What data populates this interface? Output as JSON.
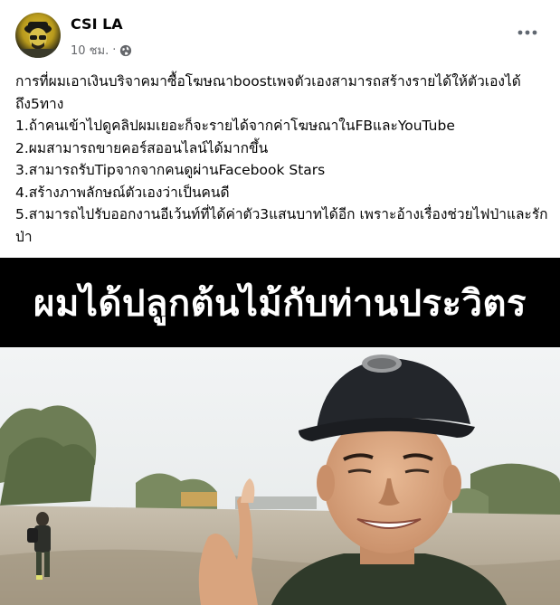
{
  "post": {
    "author": "CSI LA",
    "time": "10 ชม.",
    "separator": "·",
    "privacy_icon": "globe-icon",
    "more_icon": "more-dots-icon",
    "text_lines": [
      "การที่ผมเอาเงินบริจาคมาซื้อโฆษณาboostเพจตัวเองสามารถสร้างรายได้ให้ตัวเองได้ถึง5ทาง",
      "1.ถ้าคนเข้าไปดูคลิปผมเยอะก็จะรายได้จากค่าโฆษณาในFBและYouTube",
      "2.ผมสามารถขายคอร์สออนไลน์ได้มากขึ้น",
      "3.สามารถรับTipจากจากคนดูผ่านFacebook Stars",
      "4.สร้างภาพลักษณ์ตัวเองว่าเป็นคนดี",
      "5.สามารถไปรับออกงานอีเว้นท์ที่ได้ค่าตัว3แสนบาทได้อีก เพราะอ้างเรื่องช่วยไฟป่าและรักป่า"
    ]
  },
  "media": {
    "banner_text": "ผมได้ปลูกต้นไม้กับท่านประวิตร"
  },
  "colors": {
    "name": "#050505",
    "meta": "#65676b",
    "banner_bg": "#000000",
    "banner_text": "#ffffff"
  }
}
